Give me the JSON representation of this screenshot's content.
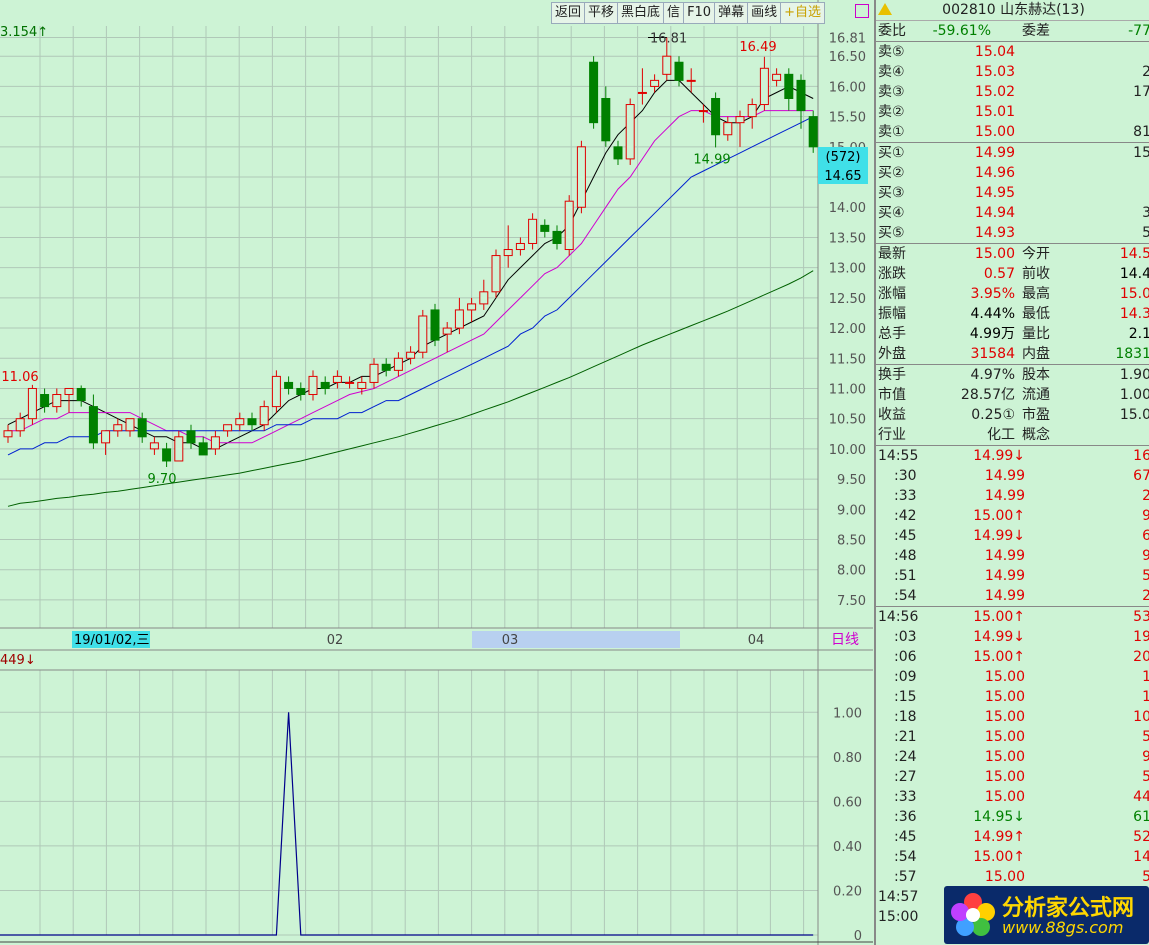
{
  "toolbar": {
    "items": [
      "返回",
      "平移",
      "黑白底",
      "信",
      "F10",
      "弹幕",
      "画线",
      "+自选"
    ]
  },
  "stock_header": "002810 山东赫达(13)",
  "date_label": "19/01/02,三",
  "month_labels": [
    "02",
    "03",
    "04"
  ],
  "period_label": "日线",
  "indicator_label": "449↓",
  "top_left_label": "3.154↑",
  "price_tag": {
    "count": "(572)",
    "price": "14.65"
  },
  "annotations": {
    "high1": "16.81",
    "high2": "16.49",
    "low1": "14.99",
    "low2": "9.70",
    "left_high": "11.06"
  },
  "order_book": {
    "wei_bi": {
      "label": "委比",
      "value": "-59.61%"
    },
    "wei_cha": {
      "label": "委差",
      "value": "-77"
    },
    "sells": [
      {
        "label": "卖⑤",
        "price": "15.04",
        "vol": ""
      },
      {
        "label": "卖④",
        "price": "15.03",
        "vol": "2"
      },
      {
        "label": "卖③",
        "price": "15.02",
        "vol": "17"
      },
      {
        "label": "卖②",
        "price": "15.01",
        "vol": ""
      },
      {
        "label": "卖①",
        "price": "15.00",
        "vol": "81"
      }
    ],
    "buys": [
      {
        "label": "买①",
        "price": "14.99",
        "vol": "15"
      },
      {
        "label": "买②",
        "price": "14.96",
        "vol": ""
      },
      {
        "label": "买③",
        "price": "14.95",
        "vol": ""
      },
      {
        "label": "买④",
        "price": "14.94",
        "vol": "3"
      },
      {
        "label": "买⑤",
        "price": "14.93",
        "vol": "5"
      }
    ]
  },
  "quote": [
    {
      "l1": "最新",
      "v1": "15.00",
      "c1": "red",
      "l2": "今开",
      "v2": "14.5",
      "c2": "red"
    },
    {
      "l1": "涨跌",
      "v1": "0.57",
      "c1": "red",
      "l2": "前收",
      "v2": "14.4",
      "c2": "blk"
    },
    {
      "l1": "涨幅",
      "v1": "3.95%",
      "c1": "red",
      "l2": "最高",
      "v2": "15.0",
      "c2": "red"
    },
    {
      "l1": "振幅",
      "v1": "4.44%",
      "c1": "blk",
      "l2": "最低",
      "v2": "14.3",
      "c2": "red"
    },
    {
      "l1": "总手",
      "v1": "4.99万",
      "c1": "blk",
      "l2": "量比",
      "v2": "2.1",
      "c2": "blk"
    },
    {
      "l1": "外盘",
      "v1": "31584",
      "c1": "red",
      "l2": "内盘",
      "v2": "1831",
      "c2": "green"
    }
  ],
  "fundamentals": [
    {
      "l1": "换手",
      "v1": "4.97%",
      "l2": "股本",
      "v2": "1.90"
    },
    {
      "l1": "市值",
      "v1": "28.57亿",
      "l2": "流通",
      "v2": "1.00"
    },
    {
      "l1": "收益",
      "v1": "0.25①",
      "l2": "市盈",
      "v2": "15.0"
    },
    {
      "l1": "行业",
      "v1": "化工",
      "l2": "概念",
      "v2": ""
    }
  ],
  "ticks": [
    {
      "t": "14:55",
      "p": "14.99↓",
      "v": "16",
      "c": "red"
    },
    {
      "t": ":30",
      "p": "14.99",
      "v": "67",
      "c": "red"
    },
    {
      "t": ":33",
      "p": "14.99",
      "v": "2",
      "c": "red"
    },
    {
      "t": ":42",
      "p": "15.00↑",
      "v": "9",
      "c": "red"
    },
    {
      "t": ":45",
      "p": "14.99↓",
      "v": "6",
      "c": "red"
    },
    {
      "t": ":48",
      "p": "14.99",
      "v": "9",
      "c": "red"
    },
    {
      "t": ":51",
      "p": "14.99",
      "v": "5",
      "c": "red"
    },
    {
      "t": ":54",
      "p": "14.99",
      "v": "2",
      "c": "red"
    },
    {
      "t": "14:56",
      "p": "15.00↑",
      "v": "53",
      "c": "red"
    },
    {
      "t": ":03",
      "p": "14.99↓",
      "v": "19",
      "c": "red"
    },
    {
      "t": ":06",
      "p": "15.00↑",
      "v": "20",
      "c": "red"
    },
    {
      "t": ":09",
      "p": "15.00",
      "v": "1",
      "c": "red"
    },
    {
      "t": ":15",
      "p": "15.00",
      "v": "1",
      "c": "red"
    },
    {
      "t": ":18",
      "p": "15.00",
      "v": "10",
      "c": "red"
    },
    {
      "t": ":21",
      "p": "15.00",
      "v": "5",
      "c": "red"
    },
    {
      "t": ":24",
      "p": "15.00",
      "v": "9",
      "c": "red"
    },
    {
      "t": ":27",
      "p": "15.00",
      "v": "5",
      "c": "red"
    },
    {
      "t": ":33",
      "p": "15.00",
      "v": "44",
      "c": "red"
    },
    {
      "t": ":36",
      "p": "14.95↓",
      "v": "61",
      "c": "green"
    },
    {
      "t": ":45",
      "p": "14.99↑",
      "v": "52",
      "c": "red"
    },
    {
      "t": ":54",
      "p": "15.00↑",
      "v": "14",
      "c": "red"
    },
    {
      "t": ":57",
      "p": "15.00",
      "v": "5",
      "c": "red"
    },
    {
      "t": "14:57",
      "p": "",
      "v": "",
      "c": "red"
    },
    {
      "t": "15:00",
      "p": "",
      "v": "",
      "c": "red"
    }
  ],
  "watermark": {
    "cn": "分析家公式网",
    "url": "www.88gs.com"
  },
  "colors": {
    "up": "#e00000",
    "down": "#008000",
    "ma5": "#000000",
    "ma10": "#d000d0",
    "ma20": "#0020d0",
    "ma60": "#006000",
    "bg": "#cdf3d5"
  },
  "chart_data": [
    {
      "type": "candlestick",
      "title": "",
      "y_ticks": [
        "16.81",
        "16.50",
        "16.00",
        "15.50",
        "15.00",
        "14.50",
        "14.00",
        "13.50",
        "13.00",
        "12.50",
        "12.00",
        "11.50",
        "11.00",
        "10.50",
        "10.00",
        "9.50",
        "9.00",
        "8.50",
        "8.00",
        "7.50"
      ],
      "ylim": [
        7.3,
        17.0
      ],
      "candles": [
        [
          10.2,
          10.4,
          10.1,
          10.3
        ],
        [
          10.3,
          10.6,
          10.2,
          10.5
        ],
        [
          10.5,
          11.06,
          10.4,
          11.0
        ],
        [
          10.9,
          11.0,
          10.6,
          10.7
        ],
        [
          10.7,
          11.0,
          10.6,
          10.9
        ],
        [
          10.9,
          11.0,
          10.6,
          11.0
        ],
        [
          11.0,
          11.05,
          10.7,
          10.8
        ],
        [
          10.7,
          10.9,
          10.0,
          10.1
        ],
        [
          10.1,
          10.3,
          9.9,
          10.3
        ],
        [
          10.3,
          10.5,
          10.2,
          10.4
        ],
        [
          10.3,
          10.5,
          10.2,
          10.5
        ],
        [
          10.5,
          10.6,
          10.1,
          10.2
        ],
        [
          10.0,
          10.2,
          9.9,
          10.1
        ],
        [
          10.0,
          10.1,
          9.7,
          9.8
        ],
        [
          9.8,
          10.3,
          9.8,
          10.2
        ],
        [
          10.3,
          10.4,
          10.0,
          10.1
        ],
        [
          10.1,
          10.2,
          9.9,
          9.9
        ],
        [
          10.0,
          10.3,
          9.9,
          10.2
        ],
        [
          10.3,
          10.4,
          10.2,
          10.4
        ],
        [
          10.4,
          10.6,
          10.3,
          10.5
        ],
        [
          10.5,
          10.6,
          10.3,
          10.4
        ],
        [
          10.4,
          10.8,
          10.3,
          10.7
        ],
        [
          10.7,
          11.3,
          10.6,
          11.2
        ],
        [
          11.1,
          11.2,
          10.9,
          11.0
        ],
        [
          11.0,
          11.1,
          10.8,
          10.9
        ],
        [
          10.9,
          11.3,
          10.8,
          11.2
        ],
        [
          11.1,
          11.2,
          10.9,
          11.0
        ],
        [
          11.1,
          11.3,
          11.0,
          11.2
        ],
        [
          11.1,
          11.2,
          11.0,
          11.1
        ],
        [
          11.0,
          11.2,
          10.9,
          11.1
        ],
        [
          11.1,
          11.5,
          11.0,
          11.4
        ],
        [
          11.4,
          11.5,
          11.2,
          11.3
        ],
        [
          11.3,
          11.6,
          11.2,
          11.5
        ],
        [
          11.5,
          11.7,
          11.4,
          11.6
        ],
        [
          11.6,
          12.3,
          11.5,
          12.2
        ],
        [
          12.3,
          12.4,
          11.7,
          11.8
        ],
        [
          11.9,
          12.1,
          11.6,
          12.0
        ],
        [
          12.0,
          12.5,
          11.9,
          12.3
        ],
        [
          12.3,
          12.5,
          12.1,
          12.4
        ],
        [
          12.4,
          12.8,
          12.3,
          12.6
        ],
        [
          12.6,
          13.3,
          12.5,
          13.2
        ],
        [
          13.2,
          13.7,
          13.0,
          13.3
        ],
        [
          13.3,
          13.5,
          13.2,
          13.4
        ],
        [
          13.4,
          13.9,
          13.3,
          13.8
        ],
        [
          13.7,
          13.8,
          13.5,
          13.6
        ],
        [
          13.6,
          13.7,
          13.3,
          13.4
        ],
        [
          13.3,
          14.2,
          13.2,
          14.1
        ],
        [
          14.0,
          15.1,
          13.9,
          15.0
        ],
        [
          16.4,
          16.5,
          15.3,
          15.4
        ],
        [
          15.8,
          16.0,
          15.0,
          15.1
        ],
        [
          15.0,
          15.1,
          14.7,
          14.8
        ],
        [
          14.8,
          15.8,
          14.7,
          15.7
        ],
        [
          15.9,
          16.3,
          15.7,
          15.9
        ],
        [
          16.0,
          16.2,
          15.9,
          16.1
        ],
        [
          16.2,
          16.81,
          16.1,
          16.5
        ],
        [
          16.4,
          16.5,
          16.0,
          16.1
        ],
        [
          16.1,
          16.3,
          15.9,
          16.1
        ],
        [
          15.6,
          15.7,
          15.4,
          15.6
        ],
        [
          15.8,
          15.9,
          14.99,
          15.2
        ],
        [
          15.2,
          15.5,
          15.1,
          15.4
        ],
        [
          15.4,
          15.6,
          15.0,
          15.5
        ],
        [
          15.5,
          15.8,
          15.3,
          15.7
        ],
        [
          15.7,
          16.49,
          15.6,
          16.3
        ],
        [
          16.1,
          16.3,
          16.0,
          16.2
        ],
        [
          16.2,
          16.3,
          15.6,
          15.8
        ],
        [
          16.1,
          16.2,
          15.3,
          15.6
        ],
        [
          15.5,
          15.6,
          14.9,
          15.0
        ]
      ],
      "ma_series": [
        {
          "name": "MA5",
          "values": [
            10.4,
            10.5,
            10.6,
            10.7,
            10.8,
            10.8,
            10.8,
            10.7,
            10.6,
            10.5,
            10.4,
            10.3,
            10.2,
            10.2,
            10.1,
            10.1,
            10.0,
            10.0,
            10.1,
            10.2,
            10.3,
            10.4,
            10.6,
            10.8,
            10.9,
            11.0,
            11.0,
            11.1,
            11.1,
            11.2,
            11.2,
            11.3,
            11.4,
            11.5,
            11.7,
            11.8,
            11.9,
            12.0,
            12.1,
            12.2,
            12.5,
            12.8,
            13.0,
            13.2,
            13.4,
            13.5,
            13.7,
            14.1,
            14.5,
            14.9,
            15.2,
            15.4,
            15.6,
            15.9,
            16.1,
            16.1,
            15.9,
            15.7,
            15.5,
            15.4,
            15.4,
            15.5,
            15.8,
            15.9,
            16.0,
            15.9,
            15.8
          ]
        },
        {
          "name": "MA10",
          "values": [
            10.3,
            10.3,
            10.4,
            10.5,
            10.5,
            10.6,
            10.6,
            10.6,
            10.6,
            10.6,
            10.6,
            10.5,
            10.4,
            10.3,
            10.3,
            10.2,
            10.2,
            10.1,
            10.1,
            10.1,
            10.1,
            10.2,
            10.3,
            10.4,
            10.5,
            10.6,
            10.7,
            10.8,
            10.9,
            10.95,
            11.0,
            11.1,
            11.2,
            11.3,
            11.4,
            11.5,
            11.6,
            11.7,
            11.8,
            11.9,
            12.1,
            12.3,
            12.5,
            12.7,
            12.9,
            13.0,
            13.2,
            13.4,
            13.7,
            14.0,
            14.3,
            14.5,
            14.8,
            15.1,
            15.3,
            15.5,
            15.6,
            15.6,
            15.5,
            15.5,
            15.5,
            15.5,
            15.6,
            15.6,
            15.6,
            15.6,
            15.6
          ]
        },
        {
          "name": "MA20",
          "values": [
            9.9,
            10.0,
            10.0,
            10.1,
            10.1,
            10.2,
            10.2,
            10.2,
            10.3,
            10.3,
            10.3,
            10.3,
            10.3,
            10.3,
            10.3,
            10.3,
            10.3,
            10.3,
            10.3,
            10.3,
            10.3,
            10.3,
            10.4,
            10.4,
            10.4,
            10.5,
            10.5,
            10.5,
            10.6,
            10.6,
            10.7,
            10.8,
            10.8,
            10.9,
            11.0,
            11.1,
            11.2,
            11.3,
            11.4,
            11.5,
            11.6,
            11.7,
            11.9,
            12.0,
            12.2,
            12.3,
            12.5,
            12.7,
            12.9,
            13.1,
            13.3,
            13.5,
            13.7,
            13.9,
            14.1,
            14.3,
            14.5,
            14.6,
            14.7,
            14.8,
            14.9,
            15.0,
            15.1,
            15.2,
            15.3,
            15.4,
            15.5
          ]
        },
        {
          "name": "MA60",
          "values": [
            9.05,
            9.1,
            9.12,
            9.15,
            9.18,
            9.2,
            9.23,
            9.25,
            9.28,
            9.3,
            9.33,
            9.36,
            9.39,
            9.42,
            9.45,
            9.48,
            9.51,
            9.54,
            9.57,
            9.6,
            9.64,
            9.68,
            9.72,
            9.76,
            9.8,
            9.85,
            9.9,
            9.95,
            10.0,
            10.05,
            10.1,
            10.15,
            10.2,
            10.26,
            10.32,
            10.38,
            10.44,
            10.5,
            10.57,
            10.64,
            10.71,
            10.78,
            10.86,
            10.94,
            11.02,
            11.1,
            11.18,
            11.27,
            11.36,
            11.45,
            11.54,
            11.63,
            11.72,
            11.8,
            11.88,
            11.96,
            12.04,
            12.12,
            12.2,
            12.28,
            12.37,
            12.46,
            12.55,
            12.64,
            12.73,
            12.83,
            12.95
          ]
        }
      ]
    },
    {
      "type": "line",
      "title": "",
      "y_ticks": [
        "1.00",
        "0.80",
        "0.60",
        "0.40",
        "0.20",
        "0"
      ],
      "ylim": [
        0,
        1.1
      ],
      "values": [
        0,
        0,
        0,
        0,
        0,
        0,
        0,
        0,
        0,
        0,
        0,
        0,
        0,
        0,
        0,
        0,
        0,
        0,
        0,
        0,
        0,
        0,
        0,
        1,
        0,
        0,
        0,
        0,
        0,
        0,
        0,
        0,
        0,
        0,
        0,
        0,
        0,
        0,
        0,
        0,
        0,
        0,
        0,
        0,
        0,
        0,
        0,
        0,
        0,
        0,
        0,
        0,
        0,
        0,
        0,
        0,
        0,
        0,
        0,
        0,
        0,
        0,
        0,
        0,
        0,
        0,
        0
      ]
    }
  ]
}
